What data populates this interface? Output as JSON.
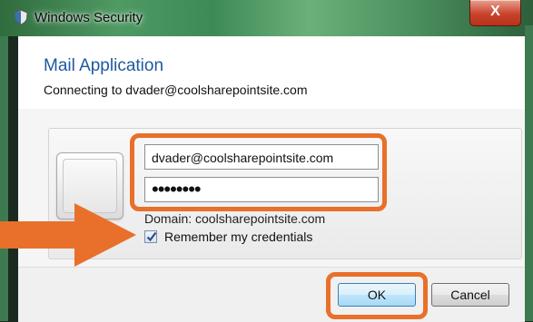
{
  "window": {
    "title": "Windows Security",
    "close_glyph": "X",
    "app_icon": "shield-icon"
  },
  "dialog": {
    "title": "Mail Application",
    "subtitle": "Connecting to dvader@coolsharepointsite.com"
  },
  "credentials": {
    "username_value": "dvader@coolsharepointsite.com",
    "password_value": "••••••••",
    "domain_text": "Domain: coolsharepointsite.com",
    "remember_label": "Remember my credentials",
    "remember_checked": true,
    "user_tile_icon": "user-tile-icon"
  },
  "buttons": {
    "ok_label": "OK",
    "cancel_label": "Cancel"
  },
  "annotations": {
    "highlight_color": "#e8702a",
    "arrow_icon": "arrow-right-icon"
  },
  "colors": {
    "title_blue": "#1e5a9e",
    "close_red": "#c9432b"
  }
}
